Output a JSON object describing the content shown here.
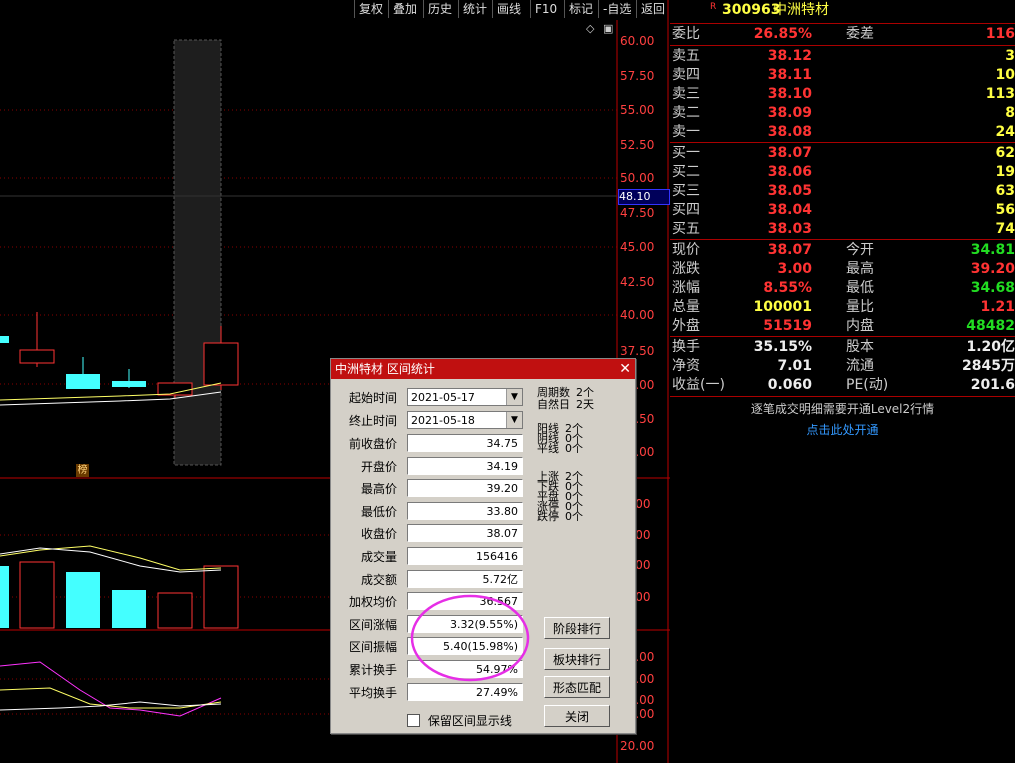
{
  "toolbar": [
    "复权",
    "叠加",
    "历史",
    "统计",
    "画线",
    "F10",
    "标记",
    "-自选",
    "返回"
  ],
  "axis": {
    "main_ticks": [
      "60.00",
      "57.50",
      "55.00",
      "52.50",
      "50.00",
      "47.50",
      "45.00",
      "42.50",
      "40.00",
      "37.50",
      "35.00",
      "32.50",
      "30.00"
    ],
    "cursor_price": "48.10",
    "vol_ticks": [
      "0000",
      "5000",
      "0000",
      "5000"
    ],
    "ind_ticks": [
      "00.00",
      "80.00",
      "60.00",
      "40.00",
      "20.00"
    ],
    "marker": "榜"
  },
  "stock": {
    "badge": "R",
    "code": "300963",
    "name": "中洲特材"
  },
  "quote": {
    "top": {
      "l1": "委比",
      "v1": "26.85%",
      "l2": "委差",
      "v2": "116"
    },
    "sell": [
      {
        "label": "卖五",
        "price": "38.12",
        "vol": "3"
      },
      {
        "label": "卖四",
        "price": "38.11",
        "vol": "10"
      },
      {
        "label": "卖三",
        "price": "38.10",
        "vol": "113"
      },
      {
        "label": "卖二",
        "price": "38.09",
        "vol": "8"
      },
      {
        "label": "卖一",
        "price": "38.08",
        "vol": "24"
      }
    ],
    "buy": [
      {
        "label": "买一",
        "price": "38.07",
        "vol": "62"
      },
      {
        "label": "买二",
        "price": "38.06",
        "vol": "19"
      },
      {
        "label": "买三",
        "price": "38.05",
        "vol": "63"
      },
      {
        "label": "买四",
        "price": "38.04",
        "vol": "56"
      },
      {
        "label": "买五",
        "price": "38.03",
        "vol": "74"
      }
    ],
    "stats": [
      {
        "l1": "现价",
        "v1": "38.07",
        "l2": "今开",
        "v2": "34.81"
      },
      {
        "l1": "涨跌",
        "v1": "3.00",
        "l2": "最高",
        "v2": "39.20"
      },
      {
        "l1": "涨幅",
        "v1": "8.55%",
        "l2": "最低",
        "v2": "34.68"
      },
      {
        "l1": "总量",
        "v1": "100001",
        "l2": "量比",
        "v2": "1.21"
      },
      {
        "l1": "外盘",
        "v1": "51519",
        "l2": "内盘",
        "v2": "48482"
      }
    ],
    "extra": [
      {
        "l1": "换手",
        "v1": "35.15%",
        "l2": "股本",
        "v2": "1.20亿"
      },
      {
        "l1": "净资",
        "v1": "7.01",
        "l2": "流通",
        "v2": "2845万"
      },
      {
        "l1": "收益(一)",
        "v1": "0.060",
        "l2": "PE(动)",
        "v2": "201.6"
      }
    ],
    "notice": "逐笔成交明细需要开通Level2行情",
    "notice_link": "点击此处开通"
  },
  "dialog": {
    "title": "中洲特材 区间统计",
    "start_label": "起始时间",
    "start": "2021-05-17",
    "end_label": "终止时间",
    "end": "2021-05-18",
    "fields": [
      {
        "label": "前收盘价",
        "value": "34.75"
      },
      {
        "label": "开盘价",
        "value": "34.19"
      },
      {
        "label": "最高价",
        "value": "39.20"
      },
      {
        "label": "最低价",
        "value": "33.80"
      },
      {
        "label": "收盘价",
        "value": "38.07"
      },
      {
        "label": "成交量",
        "value": "156416"
      },
      {
        "label": "成交额",
        "value": "5.72亿"
      },
      {
        "label": "加权均价",
        "value": "36.567"
      },
      {
        "label": "区间涨幅",
        "value": "3.32(9.55%)"
      },
      {
        "label": "区间振幅",
        "value": "5.40(15.98%)"
      },
      {
        "label": "累计换手",
        "value": "54.97%"
      },
      {
        "label": "平均换手",
        "value": "27.49%"
      }
    ],
    "period": [
      {
        "l": "周期数",
        "v": "2个"
      },
      {
        "l": "自然日",
        "v": "2天"
      }
    ],
    "yinyang": [
      {
        "l": "阳线",
        "v": "2个"
      },
      {
        "l": "阴线",
        "v": "0个"
      },
      {
        "l": "平线",
        "v": "0个"
      }
    ],
    "updown": [
      {
        "l": "上涨",
        "v": "2个"
      },
      {
        "l": "下跌",
        "v": "0个"
      },
      {
        "l": "平盘",
        "v": "0个"
      },
      {
        "l": "涨停",
        "v": "0个"
      },
      {
        "l": "跌停",
        "v": "0个"
      }
    ],
    "buttons": [
      "阶段排行",
      "板块排行",
      "形态匹配",
      "关闭"
    ],
    "checkbox_label": "保留区间显示线"
  }
}
